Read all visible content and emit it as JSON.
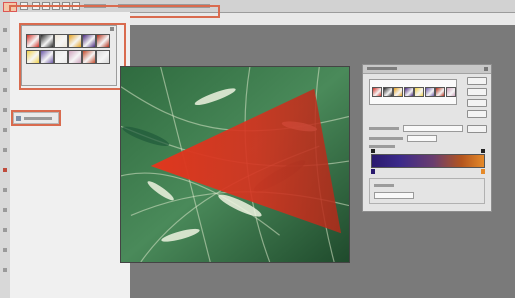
{
  "colors": {
    "highlight": "#d96b4f",
    "workspace": "#7a7a7a",
    "gradient_start": "#2a1a6e",
    "gradient_end": "#e58a2a",
    "triangle": "#d6321f"
  },
  "options_bar": {
    "icons": [
      "app-logo-icon",
      "gradient-tool-icon",
      "linear-gradient-icon",
      "radial-gradient-icon",
      "angle-gradient-icon",
      "reflected-gradient-icon",
      "diamond-gradient-icon"
    ]
  },
  "gradient_picker": {
    "swatches": [
      "#d3332a",
      "#2a2a2a",
      "#efe7d8",
      "#e6a221",
      "#4a2a80",
      "#b4301c",
      "#f1d24a",
      "#6e5ba8",
      "#e9e9e9",
      "#cfa3bd",
      "#c44c2e",
      "#d9d9d9"
    ]
  },
  "layers": {
    "icon": "layer-thumbnail-icon"
  },
  "document": {
    "image": "wheat-field-photo",
    "shape": "red-triangle"
  },
  "gradient_editor": {
    "presets": [
      "#d3332a",
      "#2a2a2a",
      "#e6a221",
      "#4a2a80",
      "#f1d24a",
      "#6e5ba8",
      "#b4301c",
      "#cfa3bd"
    ],
    "buttons": [
      "ok",
      "cancel",
      "load",
      "save",
      "new"
    ]
  }
}
